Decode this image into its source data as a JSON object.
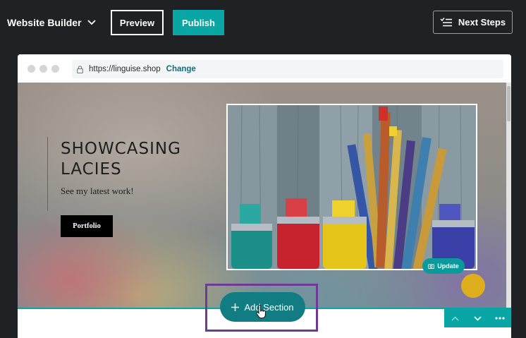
{
  "header": {
    "app_title": "Website Builder",
    "preview_label": "Preview",
    "publish_label": "Publish",
    "next_steps_label": "Next Steps"
  },
  "browser": {
    "url": "https://linguise.shop",
    "change_label": "Change"
  },
  "hero": {
    "title": "SHOWCASING LACIES",
    "subtitle": "See my latest work!",
    "button_label": "Portfolio",
    "update_label": "Update"
  },
  "editor": {
    "add_section_label": "Add Section"
  },
  "colors": {
    "accent": "#09a6a5",
    "add_section": "#117d82",
    "highlight": "#6e3a96",
    "help": "#dfae1c"
  },
  "icons": {
    "title_caret": "chevron-down-icon",
    "next_steps": "checklist-icon",
    "lock": "lock-icon",
    "update": "camera-icon",
    "add": "plus-icon",
    "section_up": "chevron-up-icon",
    "section_down": "chevron-down-icon",
    "section_more": "more-icon"
  }
}
